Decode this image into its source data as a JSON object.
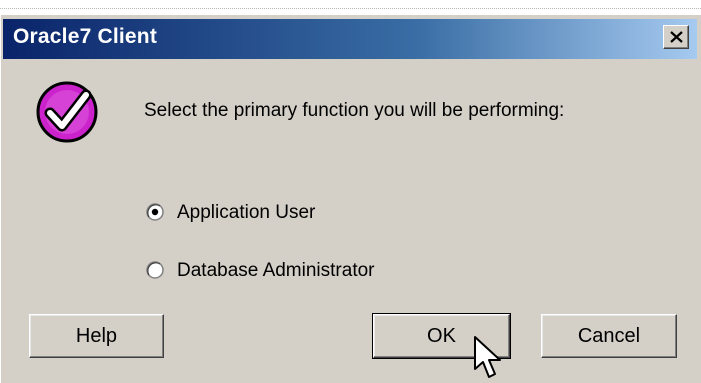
{
  "window": {
    "title": "Oracle7 Client",
    "close_icon": "close-x-icon"
  },
  "dialog": {
    "icon": "checkmark-icon",
    "prompt": "Select the primary function you will be performing:",
    "options": [
      {
        "label": "Application User",
        "selected": true
      },
      {
        "label": "Database Administrator",
        "selected": false
      }
    ]
  },
  "buttons": {
    "help": "Help",
    "ok": "OK",
    "cancel": "Cancel"
  },
  "colors": {
    "titlebar_start": "#0a246a",
    "titlebar_end": "#a6caf0",
    "face": "#d4d0c8",
    "check_badge": "#cc22cc"
  }
}
